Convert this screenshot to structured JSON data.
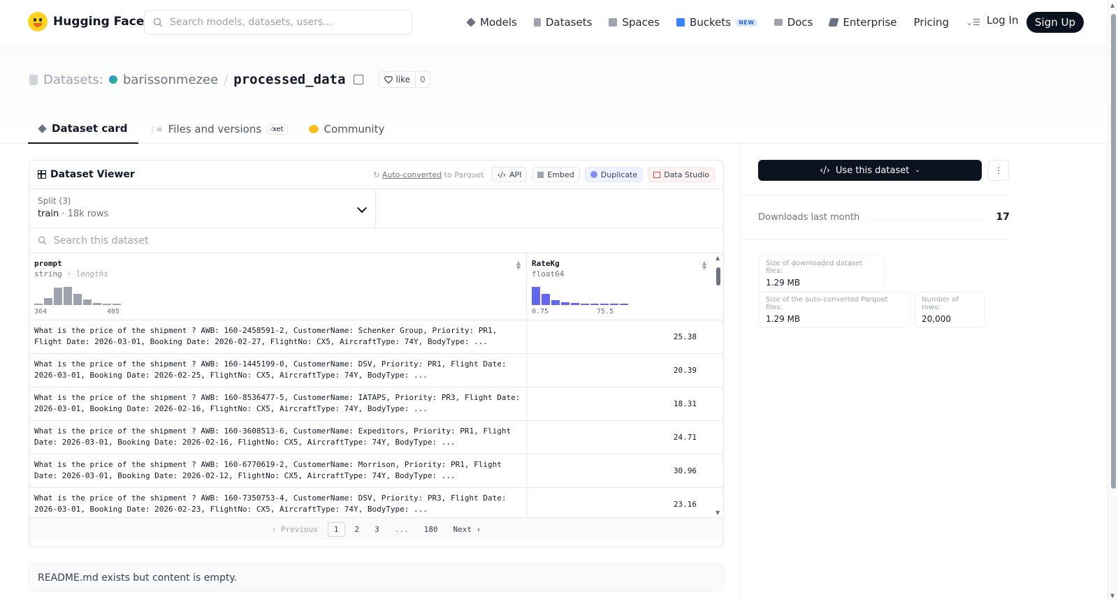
{
  "header": {
    "brand": "Hugging Face",
    "search_placeholder": "Search models, datasets, users...",
    "nav": [
      {
        "label": "Models",
        "icon": "models-icon",
        "color": "#6b7280"
      },
      {
        "label": "Datasets",
        "icon": "datasets-icon",
        "color": "#9ca3af"
      },
      {
        "label": "Spaces",
        "icon": "spaces-icon",
        "color": "#9ca3af"
      },
      {
        "label": "Buckets",
        "icon": "buckets-icon",
        "color": "#3b82f6",
        "badge": "NEW"
      },
      {
        "label": "Docs",
        "icon": "docs-icon",
        "color": "#9ca3af"
      },
      {
        "label": "Enterprise",
        "icon": "enterprise-icon",
        "color": "#6b7280"
      },
      {
        "label": "Pricing"
      }
    ],
    "login": "Log In",
    "signup": "Sign Up"
  },
  "repo": {
    "section": "Datasets:",
    "owner": "barissonmezee",
    "separator": "/",
    "name": "processed_data",
    "like_label": "like",
    "like_count": "0"
  },
  "tabs": [
    {
      "label": "Dataset card",
      "active": true
    },
    {
      "label": "Files and versions",
      "badge": "xet"
    },
    {
      "label": "Community"
    }
  ],
  "viewer": {
    "title": "Dataset Viewer",
    "auto_converted": "Auto-converted",
    "auto_converted_suffix": " to Parquet",
    "api": "API",
    "embed": "Embed",
    "duplicate": "Duplicate",
    "data_studio": "Data Studio",
    "split_label": "Split (3)",
    "split_value": "train",
    "split_rows": "18k rows",
    "search_placeholder": "Search this dataset",
    "columns": [
      {
        "name": "prompt",
        "type": "string",
        "type_extra": "lengths",
        "hist_min": "364",
        "hist_max": "405",
        "hist": [
          0.05,
          0.4,
          0.95,
          1.0,
          0.6,
          0.3,
          0.1,
          0.05,
          0.05
        ]
      },
      {
        "name": "RateKg",
        "type": "float64",
        "hist_min": "0.75",
        "hist_max": "75.5",
        "hist": [
          1.0,
          0.62,
          0.25,
          0.14,
          0.1,
          0.06,
          0.05,
          0.04,
          0.04,
          0.03
        ]
      }
    ],
    "rows": [
      {
        "prompt": "What is the price of the shipment ? AWB: 160-2458591-2, CustomerName: Schenker Group, Priority: PR1, Flight Date: 2026-03-01, Booking Date: 2026-02-27, FlightNo: CX5, AircraftType: 74Y, BodyType: ...",
        "rate": "25.38"
      },
      {
        "prompt": "What is the price of the shipment ? AWB: 160-1445199-0, CustomerName: DSV, Priority: PR1, Flight Date: 2026-03-01, Booking Date: 2026-02-25, FlightNo: CX5, AircraftType: 74Y, BodyType: ...",
        "rate": "20.39"
      },
      {
        "prompt": "What is the price of the shipment ? AWB: 160-8536477-5, CustomerName: IATAPS, Priority: PR3, Flight Date: 2026-03-01, Booking Date: 2026-02-16, FlightNo: CX5, AircraftType: 74Y, BodyType: ...",
        "rate": "18.31"
      },
      {
        "prompt": "What is the price of the shipment ? AWB: 160-3608513-6, CustomerName: Expeditors, Priority: PR1, Flight Date: 2026-03-01, Booking Date: 2026-02-16, FlightNo: CX5, AircraftType: 74Y, BodyType: ...",
        "rate": "24.71"
      },
      {
        "prompt": "What is the price of the shipment ? AWB: 160-6770619-2, CustomerName: Morrison, Priority: PR1, Flight Date: 2026-03-01, Booking Date: 2026-02-12, FlightNo: CX5, AircraftType: 74Y, BodyType: ...",
        "rate": "30.96"
      },
      {
        "prompt": "What is the price of the shipment ? AWB: 160-7350753-4, CustomerName: DSV, Priority: PR3, Flight Date: 2026-03-01, Booking Date: 2026-02-23, FlightNo: CX5, AircraftType: 74Y, BodyType: ...",
        "rate": "23.16"
      }
    ],
    "pager": {
      "previous": "Previous",
      "pages": [
        "1",
        "2",
        "3",
        "...",
        "180"
      ],
      "next": "Next",
      "current": "1"
    }
  },
  "readme": "README.md exists but content is empty.",
  "sidebar": {
    "use_button": "Use this dataset",
    "downloads_label": "Downloads last month",
    "downloads_value": "17",
    "stats": [
      {
        "key": "Size of downloaded dataset files:",
        "value": "1.29 MB"
      },
      {
        "key": "Size of the auto-converted Parquet files:",
        "value": "1.29 MB"
      },
      {
        "key": "Number of rows:",
        "value": "20,000"
      }
    ]
  }
}
